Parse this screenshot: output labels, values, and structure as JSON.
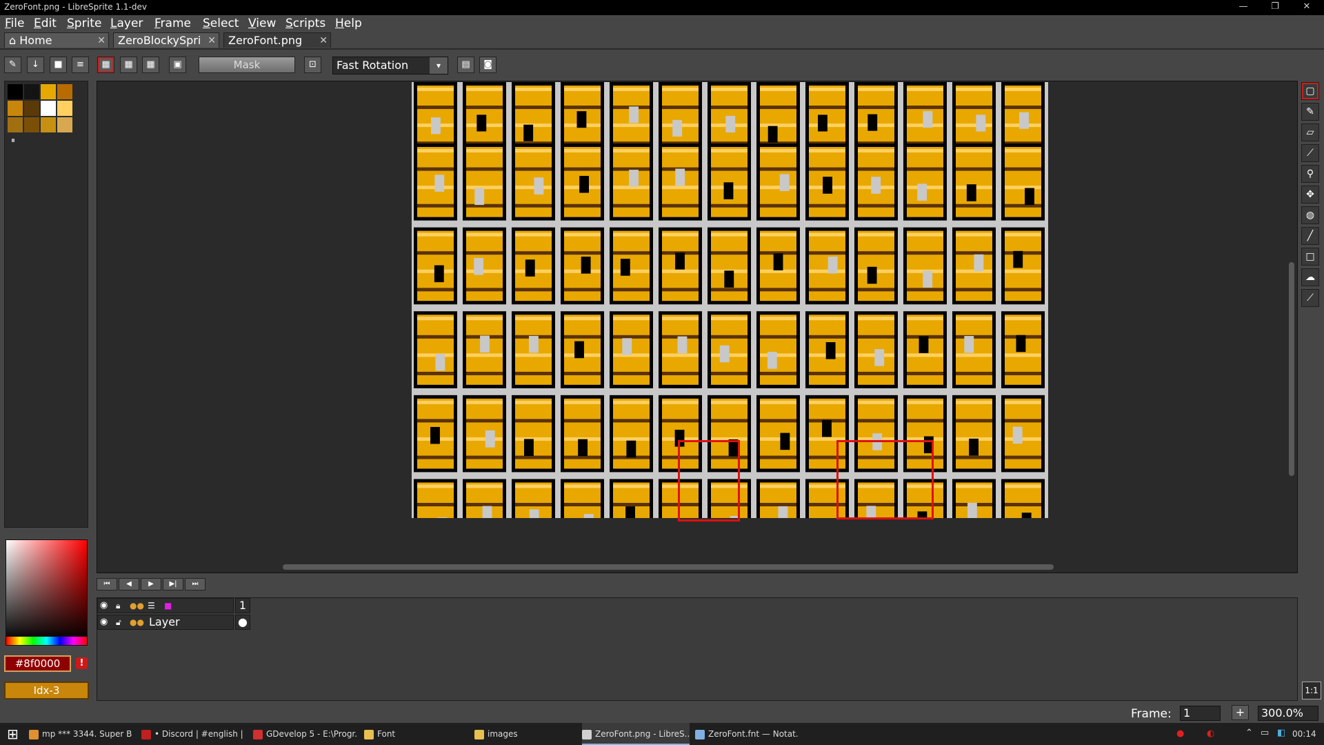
{
  "window": {
    "title": "ZeroFont.png - LibreSprite 1.1-dev",
    "minimize": "—",
    "maximize": "❐",
    "close": "✕"
  },
  "menu": [
    "File",
    "Edit",
    "Sprite",
    "Layer",
    "Frame",
    "Select",
    "View",
    "Scripts",
    "Help"
  ],
  "tabs": [
    {
      "label": "Home",
      "close": "✕"
    },
    {
      "label": "ZeroBlockySpri",
      "close": "✕"
    },
    {
      "label": "ZeroFont.png",
      "close": "✕"
    }
  ],
  "toolbar": {
    "mask_label": "Mask",
    "rotation_value": "Fast Rotation",
    "rotation_arrow": "▾"
  },
  "palette": {
    "swatches": [
      "#000000",
      "#141414",
      "#e6a800",
      "#b86c00",
      "#c8860a",
      "#5a3a08",
      "#ffffff",
      "#ffd060",
      "#a07010",
      "#7a5008",
      "#c89010",
      "#d8a850"
    ],
    "more": "⏸"
  },
  "color": {
    "fg_hex": "#8f0000",
    "warning": "!",
    "index_label": "Idx-3"
  },
  "colors": {
    "gold": "#e8a800",
    "gold_light": "#ffd060",
    "brown": "#5a3208",
    "dark": "#000000",
    "gray": "#c8c8c8",
    "highlight": "#e01010"
  },
  "tools": [
    "rect-marquee-icon",
    "pencil-icon",
    "eraser-icon",
    "eyedropper-icon",
    "zoom-icon",
    "move-icon",
    "paint-bucket-icon",
    "line-icon",
    "rectangle-icon",
    "contour-icon",
    "blur-icon"
  ],
  "timeline": {
    "buttons": [
      "⏮",
      "◀",
      "▶",
      "▶|",
      "⏭"
    ],
    "frame_header": "1",
    "layer_name": "Layer"
  },
  "status": {
    "frame_label": "Frame:",
    "frame_value": "1",
    "plus": "+",
    "zoom_value": "300.0%",
    "one_to_one": "1:1"
  },
  "taskbar": {
    "start": "⊞",
    "items": [
      {
        "label": "mp *** 3344. Super B...",
        "color": "#e09030"
      },
      {
        "label": "• Discord | #english | ...",
        "color": "#c02020"
      },
      {
        "label": "GDevelop 5 - E:\\Progr...",
        "color": "#d03030"
      },
      {
        "label": "Font",
        "color": "#e8c050"
      },
      {
        "label": "images",
        "color": "#e8c050"
      },
      {
        "label": "ZeroFont.png - LibreS...",
        "color": "#d0d0d0"
      },
      {
        "label": "ZeroFont.fnt — Notat...",
        "color": "#80b0e0"
      }
    ],
    "clock": "00:14"
  }
}
